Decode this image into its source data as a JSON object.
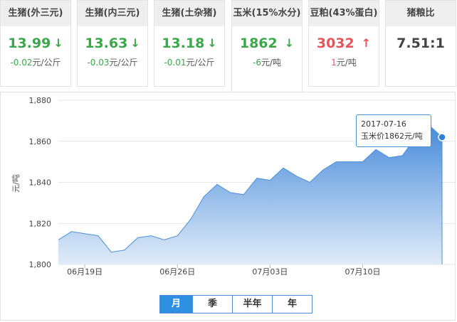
{
  "cards": [
    {
      "label": "生猪(外三元)",
      "price": "13.99",
      "dir": "down",
      "change": "-0.02",
      "unit": "元/公斤"
    },
    {
      "label": "生猪(内三元)",
      "price": "13.63",
      "dir": "down",
      "change": "-0.03",
      "unit": "元/公斤"
    },
    {
      "label": "生猪(土杂猪)",
      "price": "13.18",
      "dir": "down",
      "change": "-0.01",
      "unit": "元/公斤"
    },
    {
      "label": "玉米(15%水分)",
      "price": "1862",
      "dir": "down",
      "change": "-6",
      "unit": "元/吨"
    },
    {
      "label": "豆粕(43%蛋白)",
      "price": "3032",
      "dir": "up",
      "change": "1",
      "unit": "元/吨"
    },
    {
      "label": "猪粮比",
      "price": "7.51:1",
      "dir": "none",
      "change": "",
      "unit": ""
    }
  ],
  "colors": {
    "down": "#3aa84a",
    "up": "#e8545a",
    "accent": "#2f8fe0",
    "line": "#4a90d9"
  },
  "tooltip": {
    "date": "2017-07-16",
    "text": "玉米价1862元/吨"
  },
  "periods": [
    {
      "label": "月",
      "selected": true
    },
    {
      "label": "季",
      "selected": false
    },
    {
      "label": "半年",
      "selected": false
    },
    {
      "label": "年",
      "selected": false
    }
  ],
  "chart_data": {
    "type": "area",
    "ylabel": "元/吨",
    "ylim": [
      1800,
      1880
    ],
    "yticks": [
      "1,800",
      "1,820",
      "1,840",
      "1,860",
      "1,880"
    ],
    "xticks": [
      {
        "label": "06月19日",
        "index": 2
      },
      {
        "label": "06月26日",
        "index": 9
      },
      {
        "label": "07月03日",
        "index": 16
      },
      {
        "label": "07月10日",
        "index": 23
      }
    ],
    "dates": [
      "06-17",
      "06-18",
      "06-19",
      "06-20",
      "06-21",
      "06-22",
      "06-23",
      "06-24",
      "06-25",
      "06-26",
      "06-27",
      "06-28",
      "06-29",
      "06-30",
      "07-01",
      "07-02",
      "07-03",
      "07-04",
      "07-05",
      "07-06",
      "07-07",
      "07-08",
      "07-09",
      "07-10",
      "07-11",
      "07-12",
      "07-13",
      "07-14",
      "07-15",
      "07-16"
    ],
    "values": [
      1812,
      1816,
      1815,
      1814,
      1806,
      1807,
      1813,
      1814,
      1812,
      1814,
      1822,
      1833,
      1839,
      1835,
      1834,
      1842,
      1841,
      1847,
      1843,
      1840,
      1846,
      1850,
      1850,
      1850,
      1856,
      1852,
      1853,
      1862,
      1868,
      1862
    ]
  }
}
